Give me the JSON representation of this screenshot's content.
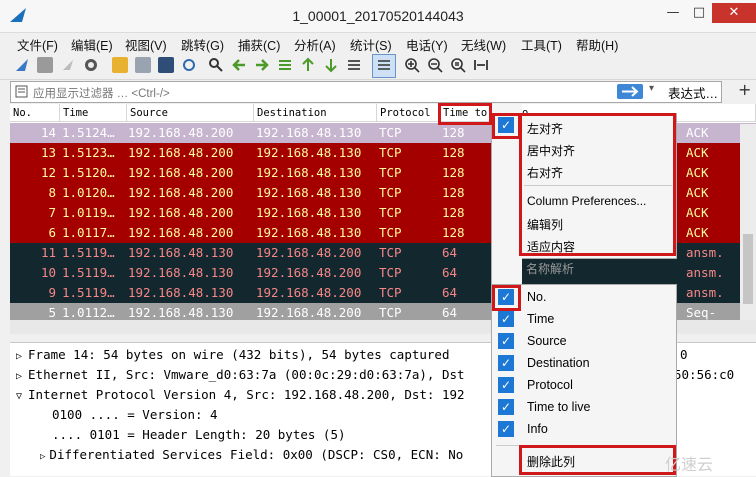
{
  "window": {
    "title": "1_00001_20170520144043",
    "minimize": "—",
    "maximize": "□",
    "close": "✕"
  },
  "menu": [
    "文件(F)",
    "编辑(E)",
    "视图(V)",
    "跳转(G)",
    "捕获(C)",
    "分析(A)",
    "统计(S)",
    "电话(Y)",
    "无线(W)",
    "工具(T)",
    "帮助(H)"
  ],
  "filter": {
    "placeholder": "应用显示过滤器 … <Ctrl-/>",
    "expression_label": "表达式…",
    "add_label": "+"
  },
  "packet_list": {
    "columns": [
      "No.",
      "Time",
      "Source",
      "Destination",
      "Protocol",
      "Time to live",
      "Info"
    ],
    "rows": [
      {
        "no": "14",
        "time": "1.5124…",
        "src": "192.168.48.200",
        "dst": "192.168.48.130",
        "proto": "TCP",
        "ttl": "128",
        "info": "ACK"
      },
      {
        "no": "13",
        "time": "1.5123…",
        "src": "192.168.48.200",
        "dst": "192.168.48.130",
        "proto": "TCP",
        "ttl": "128",
        "info": "ACK"
      },
      {
        "no": "12",
        "time": "1.5120…",
        "src": "192.168.48.200",
        "dst": "192.168.48.130",
        "proto": "TCP",
        "ttl": "128",
        "info": "ACK"
      },
      {
        "no": "8",
        "time": "1.0120…",
        "src": "192.168.48.200",
        "dst": "192.168.48.130",
        "proto": "TCP",
        "ttl": "128",
        "info": "ACK"
      },
      {
        "no": "7",
        "time": "1.0119…",
        "src": "192.168.48.200",
        "dst": "192.168.48.130",
        "proto": "TCP",
        "ttl": "128",
        "info": "ACK"
      },
      {
        "no": "6",
        "time": "1.0117…",
        "src": "192.168.48.200",
        "dst": "192.168.48.130",
        "proto": "TCP",
        "ttl": "128",
        "info": "ACK"
      },
      {
        "no": "11",
        "time": "1.5119…",
        "src": "192.168.48.130",
        "dst": "192.168.48.200",
        "proto": "TCP",
        "ttl": "64",
        "info": "ansm."
      },
      {
        "no": "10",
        "time": "1.5119…",
        "src": "192.168.48.130",
        "dst": "192.168.48.200",
        "proto": "TCP",
        "ttl": "64",
        "info": "ansm."
      },
      {
        "no": "9",
        "time": "1.5119…",
        "src": "192.168.48.130",
        "dst": "192.168.48.200",
        "proto": "TCP",
        "ttl": "64",
        "info": "ansm."
      },
      {
        "no": "5",
        "time": "1.0112…",
        "src": "192.168.48.130",
        "dst": "192.168.48.200",
        "proto": "TCP",
        "ttl": "64",
        "info": "Seq-"
      }
    ]
  },
  "details": {
    "lines": [
      "Frame 14: 54 bytes on wire (432 bits), 54 bytes captured",
      "Ethernet II, Src: Vmware_d0:63:7a (00:0c:29:d0:63:7a), Dst",
      "Internet Protocol Version 4, Src: 192.168.48.200, Dst: 192",
      "0100 .... = Version: 4",
      ".... 0101 = Header Length: 20 bytes (5)",
      "Differentiated Services Field: 0x00 (DSCP: CS0, ECN: No"
    ],
    "right_fragments": [
      "0",
      "50:56:c0"
    ]
  },
  "align_menu": {
    "items": [
      "左对齐",
      "居中对齐",
      "右对齐",
      "Column Preferences...",
      "编辑列",
      "适应内容",
      "名称解析"
    ]
  },
  "columns_menu": {
    "items": [
      "No.",
      "Time",
      "Source",
      "Destination",
      "Protocol",
      "Time to live",
      "Info"
    ],
    "delete_label": "删除此列"
  },
  "watermark": "亿速云",
  "colors": {
    "red_row_bg": "#a40000",
    "red_row_fg": "#fffc9c",
    "dark_row_bg": "#12272e",
    "dark_row_fg": "#f78787",
    "selected_row_bg": "#c7b5cf",
    "highlight_red": "#d0181b",
    "check_blue": "#1c78d4"
  }
}
